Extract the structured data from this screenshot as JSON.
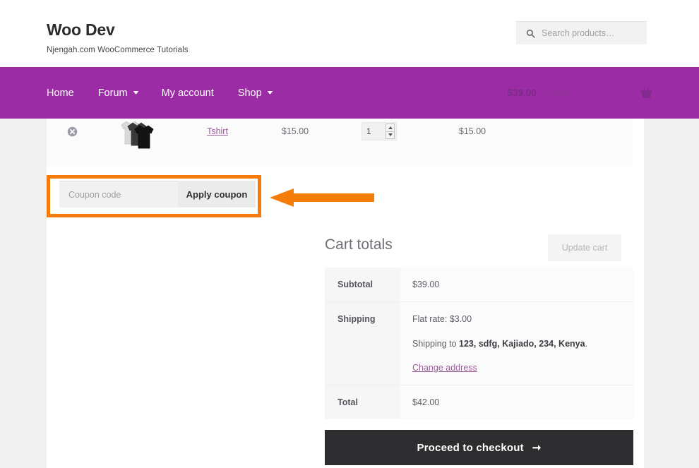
{
  "header": {
    "brand_title": "Woo Dev",
    "brand_tagline": "Njengah.com WooCommerce Tutorials",
    "search": {
      "placeholder": "Search products…",
      "value": "",
      "icon": "search-icon"
    }
  },
  "nav": {
    "background_color": "#9c2ba6",
    "items": [
      {
        "label": "Home",
        "has_dropdown": false
      },
      {
        "label": "Forum",
        "has_dropdown": true
      },
      {
        "label": "My account",
        "has_dropdown": false
      },
      {
        "label": "Shop",
        "has_dropdown": true
      }
    ],
    "cart": {
      "amount": "$39.00",
      "count": "2 items",
      "icon": "shopping-basket-icon"
    }
  },
  "cart_table": {
    "row": {
      "remove_icon": "remove-item-icon",
      "thumbnail_icon": "tshirt-product-thumbnail",
      "product_name": "Tshirt",
      "price": "$15.00",
      "quantity": "1",
      "subtotal": "$15.00"
    }
  },
  "coupon": {
    "placeholder": "Coupon code",
    "value": "",
    "apply_label": "Apply coupon",
    "highlight_color": "#f57c0a",
    "annotation_arrow": "left-pointing-arrow-annotation"
  },
  "update_cart": {
    "label": "Update cart",
    "disabled": true
  },
  "totals": {
    "heading": "Cart totals",
    "rows": [
      {
        "label": "Subtotal",
        "value": "$39.00"
      },
      {
        "label": "Shipping",
        "value": ""
      },
      {
        "label": "Total",
        "value": "$42.00"
      }
    ],
    "shipping": {
      "method": "Flat rate: $3.00",
      "address_prefix": "Shipping to ",
      "address": "123, sdfg, Kajiado, 234, Kenya",
      "address_suffix": ".",
      "change_address_label": "Change address"
    }
  },
  "checkout": {
    "label": "Proceed to checkout",
    "arrow": "➞"
  }
}
